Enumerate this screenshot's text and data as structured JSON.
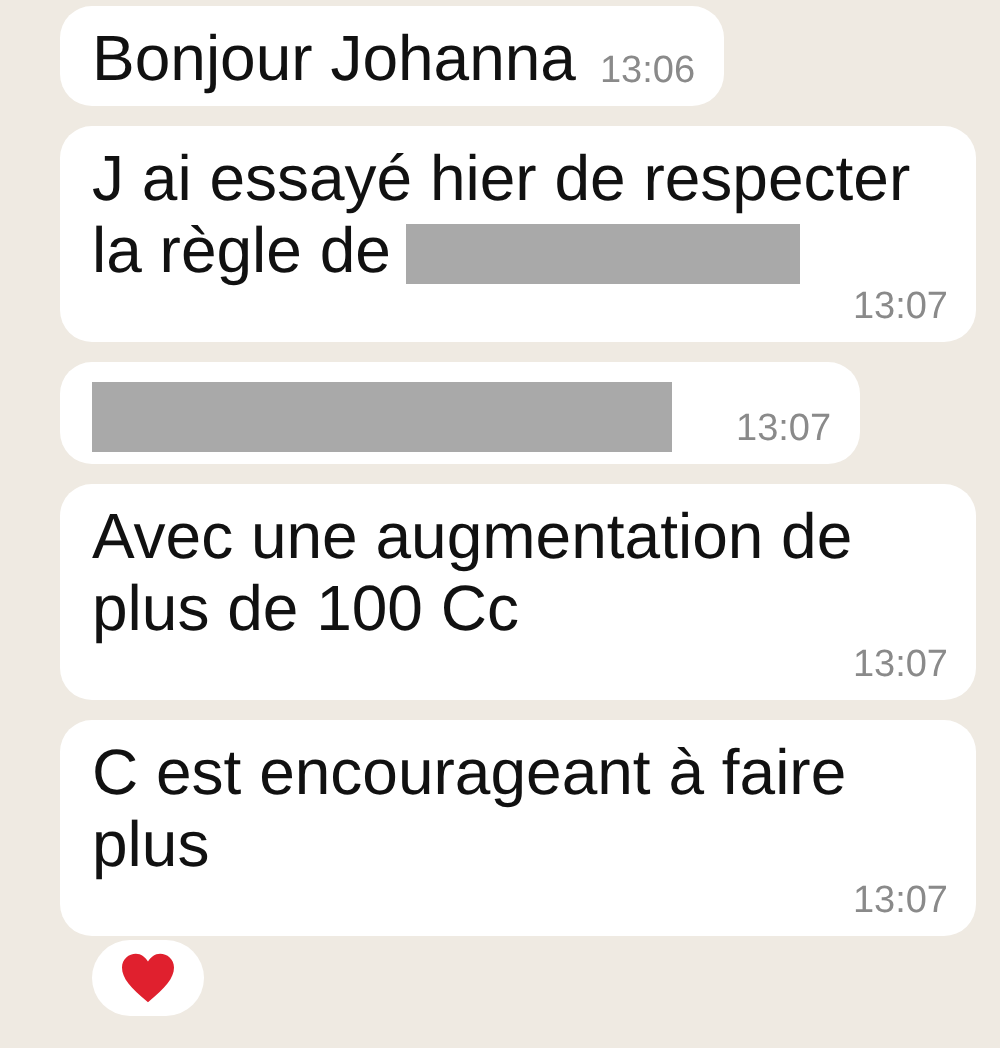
{
  "messages": [
    {
      "text": "Bonjour Johanna",
      "redacted": false,
      "time": "13:06"
    },
    {
      "text": "J ai essayé hier de respecter la règle de",
      "redacted": true,
      "time": "13:07"
    },
    {
      "redacted": true,
      "time": "13:07"
    },
    {
      "text": "Avec une augmentation de plus de 100 Cc",
      "redacted": false,
      "time": "13:07"
    },
    {
      "text": "C est encourageant à faire plus",
      "redacted": false,
      "time": "13:07"
    }
  ],
  "reaction": {
    "kind": "heart"
  }
}
